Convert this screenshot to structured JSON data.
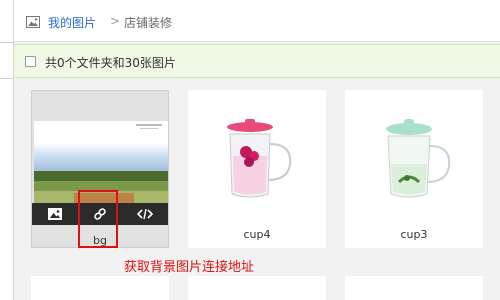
{
  "breadcrumb": {
    "link": "我的图片",
    "separator": ">",
    "current": "店铺装修"
  },
  "infobar": {
    "summary": "共0个文件夹和30张图片"
  },
  "cards": [
    {
      "name": "bg"
    },
    {
      "name": "cup4"
    },
    {
      "name": "cup3"
    }
  ],
  "annotation": "获取背景图片连接地址",
  "colors": {
    "link": "#2b6cd6",
    "info_bg": "#eef9e6",
    "toolbar": "#2b2b2b",
    "annotation": "#e01010"
  },
  "icons": [
    "image-folder-icon",
    "image-icon",
    "link-icon",
    "code-icon"
  ]
}
